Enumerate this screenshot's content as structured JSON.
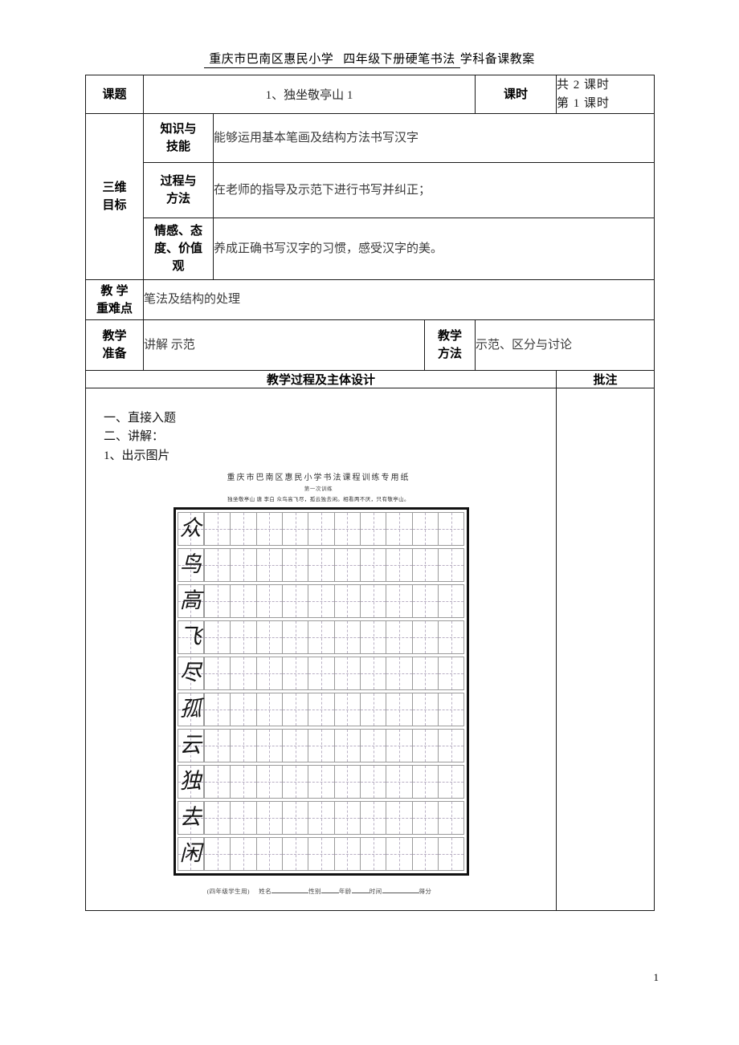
{
  "document": {
    "header": {
      "school": "重庆市巴南区惠民小学",
      "course": "四年级下册硬笔书法",
      "suffix": "学科备课教案"
    },
    "page_number": "1"
  },
  "table": {
    "topic_label": "课题",
    "topic_value": "1、独坐敬亭山 1",
    "periods_label": "课时",
    "periods_value": "共 2 课时\n第 1 课时",
    "objectives_label": "三维\n目标",
    "objectives": [
      {
        "sub_label": "知识与\n技能",
        "text": "能够运用基本笔画及结构方法书写汉字"
      },
      {
        "sub_label": "过程与\n方法",
        "text": "在老师的指导及示范下进行书写并纠正；"
      },
      {
        "sub_label": "情感、态\n度、价值\n观",
        "text": "养成正确书写汉字的习惯，感受汉字的美。"
      }
    ],
    "key_points_label": "教 学\n重难点",
    "key_points_value": "笔法及结构的处理",
    "preparation_label": "教学\n准备",
    "preparation_value": "讲解 示范",
    "method_label": "教学\n方法",
    "method_value": "示范、区分与讨论",
    "process_header": "教学过程及主体设计",
    "notes_header": "批注"
  },
  "lesson_body": {
    "steps": [
      "一、直接入题",
      "二、讲解：",
      "1、出示图片"
    ]
  },
  "worksheet": {
    "title": "重庆市巴南区惠民小学书法课程训练专用纸",
    "subtitle": "第一次训练",
    "poem": "独坐敬亭山 唐 李白 众鸟高飞尽，孤云独去闲。相看两不厌，只有敬亭山。",
    "columns": 11,
    "rows": [
      "众",
      "鸟",
      "高",
      "飞",
      "尽",
      "孤",
      "云",
      "独",
      "去",
      "闲"
    ],
    "footer": {
      "grade": "(四年级学生用)",
      "name_label": "姓名",
      "gender_label": "性别",
      "age_label": "年龄",
      "time_label": "时间",
      "score_label": "得分"
    }
  }
}
